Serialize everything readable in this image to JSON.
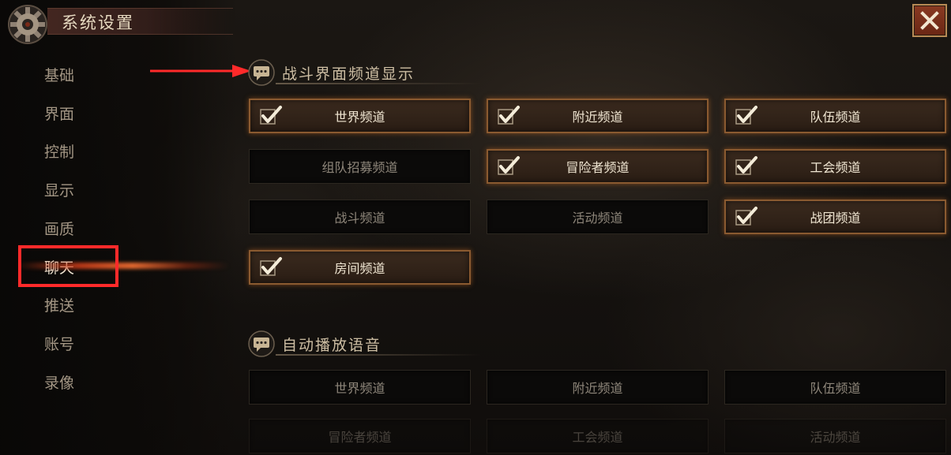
{
  "header": {
    "title": "系统设置",
    "icon": "gear-icon",
    "close_icon": "close-icon"
  },
  "colors": {
    "accent_orange": "#8a5a30",
    "close_button": "#8a3a22",
    "highlight_box": "#ff2a2a"
  },
  "sidebar": {
    "active_index": 5,
    "items": [
      {
        "label": "基础"
      },
      {
        "label": "界面"
      },
      {
        "label": "控制"
      },
      {
        "label": "显示"
      },
      {
        "label": "画质"
      },
      {
        "label": "聊天"
      },
      {
        "label": "推送"
      },
      {
        "label": "账号"
      },
      {
        "label": "录像"
      }
    ]
  },
  "sections": [
    {
      "title": "战斗界面频道显示",
      "icon": "chat-bubble-icon",
      "options": [
        {
          "label": "世界频道",
          "checked": true
        },
        {
          "label": "附近频道",
          "checked": true
        },
        {
          "label": "队伍频道",
          "checked": true
        },
        {
          "label": "组队招募频道",
          "checked": false
        },
        {
          "label": "冒险者频道",
          "checked": true
        },
        {
          "label": "工会频道",
          "checked": true
        },
        {
          "label": "战斗频道",
          "checked": false
        },
        {
          "label": "活动频道",
          "checked": false
        },
        {
          "label": "战团频道",
          "checked": true
        },
        {
          "label": "房间频道",
          "checked": true
        }
      ]
    },
    {
      "title": "自动播放语音",
      "icon": "chat-bubble-icon",
      "options": [
        {
          "label": "世界频道",
          "checked": false
        },
        {
          "label": "附近频道",
          "checked": false
        },
        {
          "label": "队伍频道",
          "checked": false
        },
        {
          "label": "冒险者频道",
          "checked": false
        },
        {
          "label": "工会频道",
          "checked": false
        },
        {
          "label": "活动频道",
          "checked": false
        }
      ]
    }
  ]
}
